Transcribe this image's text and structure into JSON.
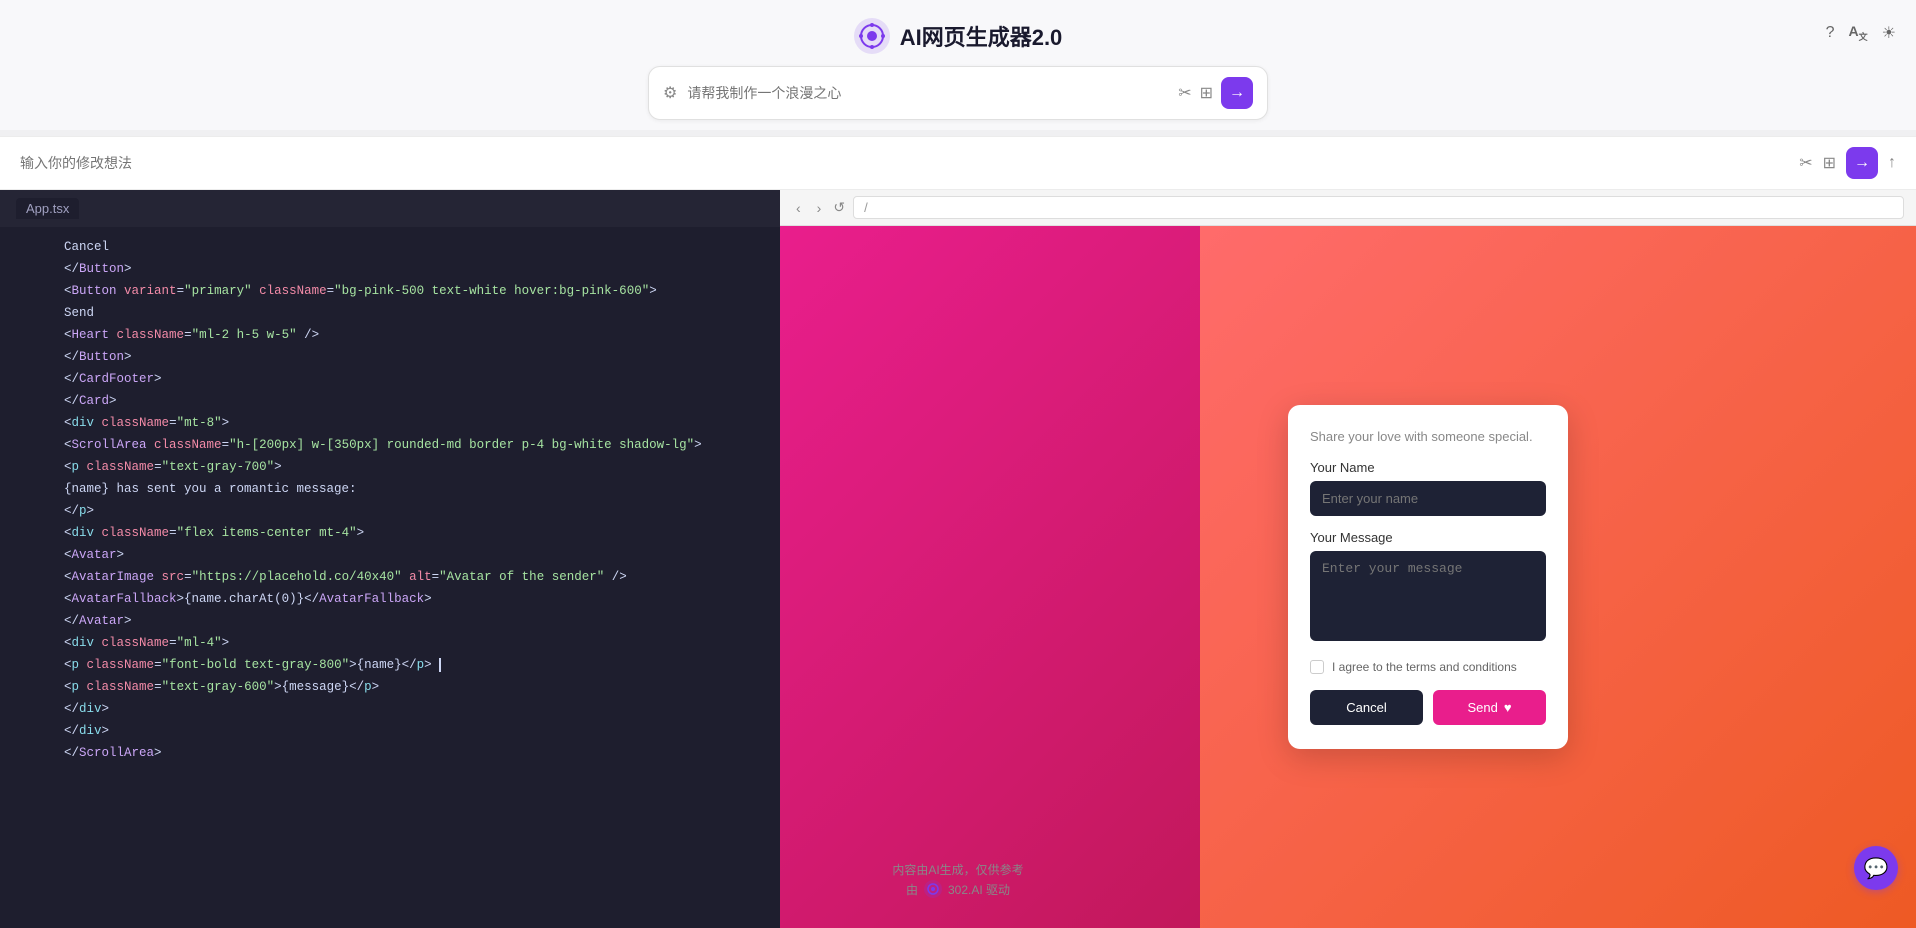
{
  "header": {
    "title": "AI网页生成器2.0",
    "icon_label": "ai-icon"
  },
  "header_icons": {
    "help": "?",
    "translate": "A",
    "theme": "☀"
  },
  "prompt_bar": {
    "placeholder": "请帮我制作一个浪漫之心",
    "gear_label": "⚙",
    "magic_label": "✂",
    "image_label": "🖼",
    "send_label": "→"
  },
  "modify_bar": {
    "placeholder": "输入你的修改想法",
    "magic_label": "✂",
    "image_label": "🖼",
    "send_label": "→",
    "export_label": "↑"
  },
  "file_tab": {
    "name": "App.tsx"
  },
  "code_lines": [
    {
      "num": "",
      "content": "Cancel"
    },
    {
      "num": "",
      "content": "</Button>"
    },
    {
      "num": "",
      "content": "<Button variant=\"primary\" className=\"bg-pink-500 text-white hover:bg-pink-600\">"
    },
    {
      "num": "",
      "content": "  Send"
    },
    {
      "num": "",
      "content": "  <Heart className=\"ml-2 h-5 w-5\" />"
    },
    {
      "num": "",
      "content": "</Button>"
    },
    {
      "num": "",
      "content": "</CardFooter>"
    },
    {
      "num": "",
      "content": "</Card>"
    },
    {
      "num": "",
      "content": "<div className=\"mt-8\">"
    },
    {
      "num": "",
      "content": "  <ScrollArea className=\"h-[200px] w-[350px] rounded-md border p-4 bg-white shadow-lg\">"
    },
    {
      "num": "",
      "content": "    <p className=\"text-gray-700\">"
    },
    {
      "num": "",
      "content": "      {name} has sent you a romantic message:"
    },
    {
      "num": "",
      "content": "    </p>"
    },
    {
      "num": "",
      "content": "    <div className=\"flex items-center mt-4\">"
    },
    {
      "num": "",
      "content": "      <Avatar>"
    },
    {
      "num": "",
      "content": "        <AvatarImage src=\"https://placehold.co/40x40\" alt=\"Avatar of the sender\" />"
    },
    {
      "num": "",
      "content": "        <AvatarFallback>{name.charAt(0)}</AvatarFallback>"
    },
    {
      "num": "",
      "content": "      </Avatar>"
    },
    {
      "num": "",
      "content": "      <div className=\"ml-4\">"
    },
    {
      "num": "",
      "content": "        <p className=\"font-bold text-gray-800\">{name}</p>"
    },
    {
      "num": "",
      "content": "        <p className=\"text-gray-600\">{message}</p>"
    },
    {
      "num": "",
      "content": "      </div>"
    },
    {
      "num": "",
      "content": "    </div>"
    },
    {
      "num": "",
      "content": "  </ScrollArea>"
    }
  ],
  "preview": {
    "url": "/",
    "card": {
      "subtitle": "Share your love with someone special.",
      "name_label": "Your Name",
      "name_placeholder": "Enter your name",
      "message_label": "Your Message",
      "message_placeholder": "Enter your message",
      "checkbox_label": "I agree to the terms and conditions",
      "cancel_label": "Cancel",
      "send_label": "Send",
      "heart_icon": "♥"
    }
  },
  "footer": {
    "line1": "内容由AI生成，仅供参考",
    "line2": "由",
    "brand": "302.AI 驱动"
  },
  "chat_bubble": {
    "icon": "💬"
  }
}
